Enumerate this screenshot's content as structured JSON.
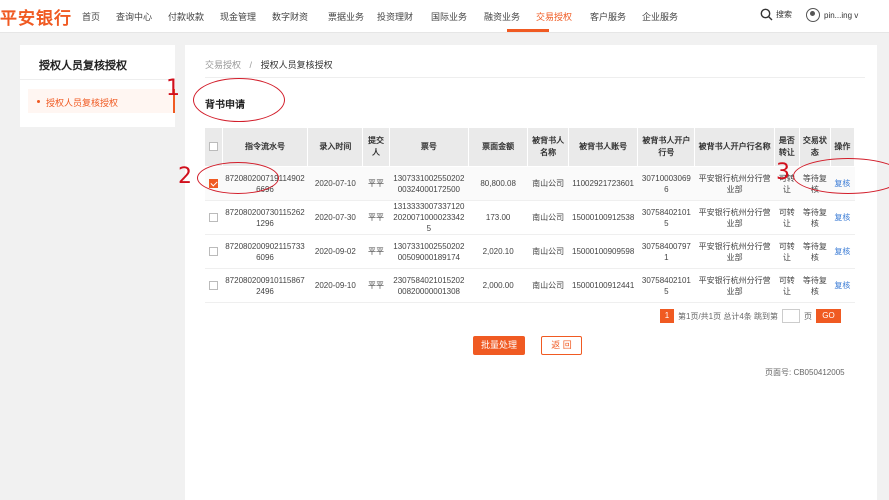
{
  "brand": {
    "logo_text": "平安银行"
  },
  "nav": {
    "items": [
      "首页",
      "查询中心",
      "付款收款",
      "现金管理",
      "数字财资",
      "票据业务",
      "投资理财",
      "国际业务",
      "融资业务",
      "交易授权",
      "客户服务",
      "企业服务"
    ],
    "active_index": 9,
    "search_label": "搜索",
    "user_name": "pin...ing v"
  },
  "sidebar": {
    "title": "授权人员复核授权",
    "items": [
      {
        "label": "授权人员复核授权",
        "active": true
      }
    ]
  },
  "breadcrumb": {
    "parent": "交易授权",
    "separator": "/",
    "current": "授权人员复核授权"
  },
  "section_title": "背书申请",
  "table": {
    "headers": [
      "指令流水号",
      "录入时间",
      "提交人",
      "票号",
      "票面金额",
      "被背书人名称",
      "被背书人账号",
      "被背书人开户行号",
      "被背书人开户行名称",
      "是否转让",
      "交易状态",
      "操作"
    ],
    "rows": [
      {
        "checked": true,
        "serial": "8720802007191149026696",
        "time": "2020-07-10",
        "submitter": "平平",
        "bill_no": "130733100255020200324000172500",
        "amount": "80,800.08",
        "payee": "南山公司",
        "account": "11002921723601",
        "bank_no": "307100030696",
        "bank_name": "平安银行杭州分行营业部",
        "transfer": "可转让",
        "status": "等待复核",
        "action": "复核"
      },
      {
        "checked": false,
        "serial": "8720802007301152621296",
        "time": "2020-07-30",
        "submitter": "平平",
        "bill_no": "131333300733712020200710000233425",
        "amount": "173.00",
        "payee": "南山公司",
        "account": "15000100912538",
        "bank_no": "307584021015",
        "bank_name": "平安银行杭州分行营业部",
        "transfer": "可转让",
        "status": "等待复核",
        "action": "复核"
      },
      {
        "checked": false,
        "serial": "8720802009021157336096",
        "time": "2020-09-02",
        "submitter": "平平",
        "bill_no": "130733100255020200509000189174",
        "amount": "2,020.10",
        "payee": "南山公司",
        "account": "15000100909598",
        "bank_no": "307584007971",
        "bank_name": "平安银行杭州分行营业部",
        "transfer": "可转让",
        "status": "等待复核",
        "action": "复核"
      },
      {
        "checked": false,
        "serial": "8720802009101158672496",
        "time": "2020-09-10",
        "submitter": "平平",
        "bill_no": "230758402101520200820000001308",
        "amount": "2,000.00",
        "payee": "南山公司",
        "account": "15000100912441",
        "bank_no": "307584021015",
        "bank_name": "平安银行杭州分行营业部",
        "transfer": "可转让",
        "status": "等待复核",
        "action": "复核"
      }
    ]
  },
  "pagination": {
    "current_page": "1",
    "summary": "第1页/共1页 总计4条 跳到第",
    "suffix": "页",
    "go_label": "GO"
  },
  "buttons": {
    "batch": "批量处理",
    "back": "返 回"
  },
  "page_code": "页面号: CB050412005",
  "annotations": {
    "one": "1",
    "two": "2",
    "three": "3"
  },
  "colors": {
    "accent": "#f05a22",
    "link": "#3a7bd5",
    "annotation": "#d10f1c"
  }
}
